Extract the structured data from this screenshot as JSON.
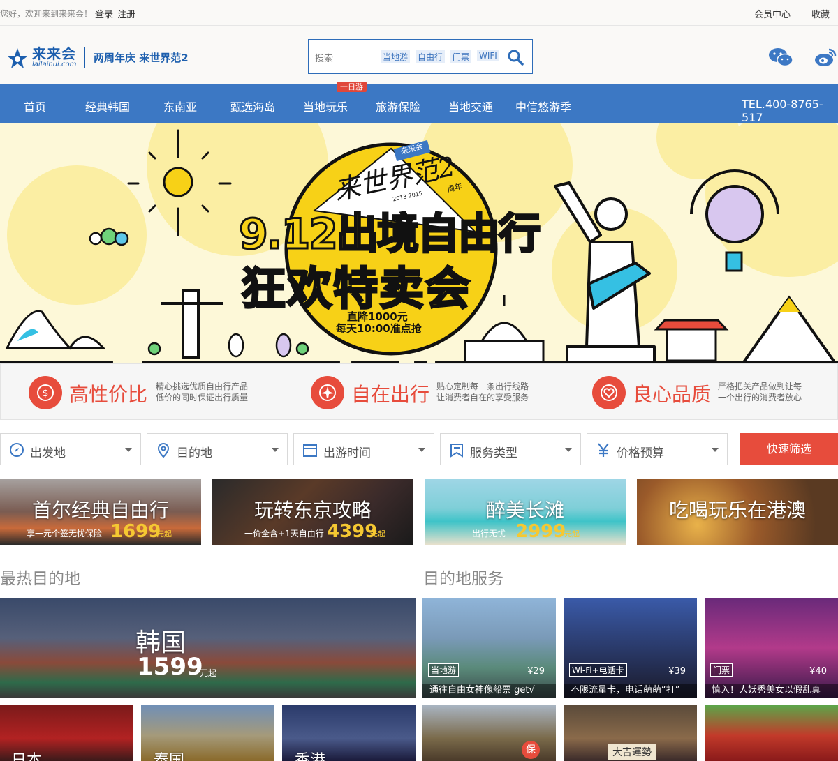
{
  "topbar": {
    "welcome": "您好，欢迎来到来来会！",
    "login": "登录",
    "register": "注册",
    "member": "会员中心",
    "fav": "收藏"
  },
  "header": {
    "logo": "来来会",
    "logo_sub": "lailaihui.com",
    "slogan": "两周年庆 来世界范2"
  },
  "search": {
    "placeholder": "搜索",
    "tags": [
      "当地游",
      "自由行",
      "门票",
      "WIFI"
    ]
  },
  "nav": {
    "items": [
      "首页",
      "经典韩国",
      "东南亚",
      "甄选海岛",
      "当地玩乐",
      "旅游保险",
      "当地交通",
      "中信悠游季"
    ],
    "badge": "一日游",
    "tel": "TEL.400-8765-517"
  },
  "banner": {
    "brand": "来来会",
    "anniv_title": "来世界范2",
    "anniv_label": "周年",
    "years": "2013 2015",
    "headline1": "9.12出境自由行",
    "headline2": "狂欢特卖会",
    "note1": "直降1000元",
    "note2": "每天10:00准点抢"
  },
  "features": [
    {
      "title": "高性价比",
      "desc": [
        "精心挑选优质自由行产品",
        "低价的同时保证出行质量"
      ]
    },
    {
      "title": "自在出行",
      "desc": [
        "贴心定制每一条出行线路",
        "让消费者自在的享受服务"
      ]
    },
    {
      "title": "良心品质",
      "desc": [
        "严格把关产品做到让每",
        "一个出行的消费者放心"
      ]
    }
  ],
  "filters": {
    "items": [
      "出发地",
      "目的地",
      "出游时间",
      "服务类型",
      "价格预算"
    ],
    "button": "快速筛选"
  },
  "promos": [
    {
      "title": "首尔经典自由行",
      "sub": "享一元个签无忧保险",
      "price": "1699",
      "unit": "元起"
    },
    {
      "title": "玩转东京攻略",
      "sub": "一价全含+1天自由行",
      "price": "4399",
      "unit": "元起"
    },
    {
      "title": "醉美长滩",
      "sub": "出行无忧",
      "price": "2999",
      "unit": "元起"
    },
    {
      "title": "吃喝玩乐在港澳",
      "sub": "",
      "price": "",
      "unit": ""
    }
  ],
  "sections": {
    "hot": "最热目的地",
    "service": "目的地服务"
  },
  "hot": {
    "korea": "韩国",
    "korea_price": "1599",
    "korea_unit": "元起",
    "japan": "日本",
    "thailand": "泰国",
    "hongkong": "香港"
  },
  "services": [
    {
      "tag": "当地游",
      "price": "¥29",
      "caption": "通往自由女神像船票 get√"
    },
    {
      "tag": "Wi-Fi+电话卡",
      "price": "¥39",
      "caption": "不限流量卡，电话萌萌“打”"
    },
    {
      "tag": "门票",
      "price": "¥40",
      "caption": "慎入！人妖秀美女以假乱真"
    }
  ],
  "extra": {
    "bao": "保",
    "sign": "大吉運勢"
  }
}
